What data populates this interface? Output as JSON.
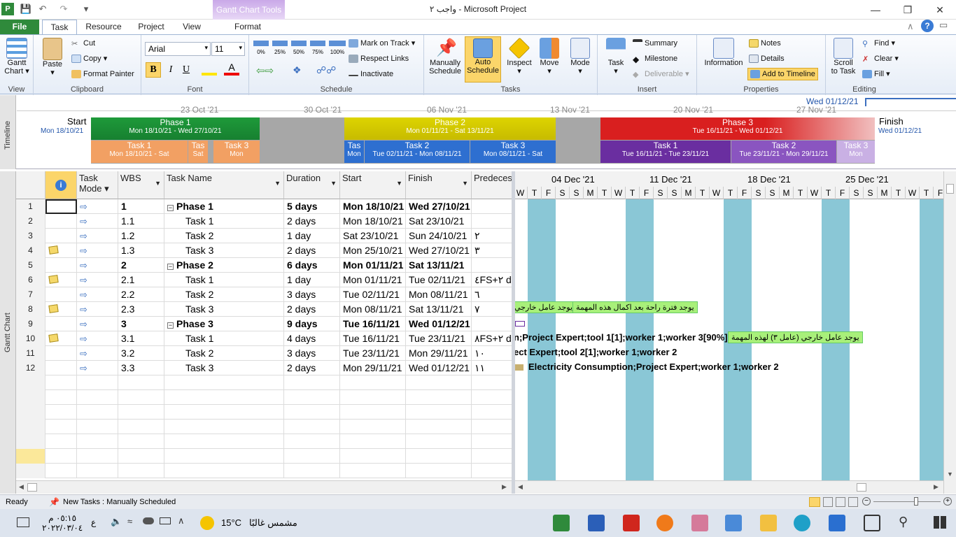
{
  "window": {
    "title": "واجب ٢  -  Microsoft Project",
    "contextual_tab": "Gantt Chart Tools"
  },
  "tabs": [
    {
      "label": "File"
    },
    {
      "label": "Task"
    },
    {
      "label": "Resource"
    },
    {
      "label": "Project"
    },
    {
      "label": "View"
    },
    {
      "label": "Format"
    }
  ],
  "ribbon": {
    "view": {
      "label": "View",
      "gantt": "Gantt",
      "gantt2": "Chart"
    },
    "clipboard": {
      "label": "Clipboard",
      "paste": "Paste",
      "cut": "Cut",
      "copy": "Copy",
      "painter": "Format Painter"
    },
    "font": {
      "label": "Font",
      "family": "Arial",
      "size": "11"
    },
    "schedule": {
      "label": "Schedule",
      "mark": "Mark on Track",
      "respect": "Respect Links",
      "inactivate": "Inactivate",
      "pcts": [
        "0%",
        "25%",
        "50%",
        "75%",
        "100%"
      ]
    },
    "tasks": {
      "label": "Tasks",
      "manual1": "Manually",
      "manual2": "Schedule",
      "auto1": "Auto",
      "auto2": "Schedule",
      "inspect": "Inspect",
      "move": "Move",
      "mode": "Mode"
    },
    "insert": {
      "label": "Insert",
      "task": "Task",
      "summary": "Summary",
      "milestone": "Milestone",
      "deliverable": "Deliverable"
    },
    "properties": {
      "label": "Properties",
      "information": "Information",
      "notes": "Notes",
      "details": "Details",
      "add_tl": "Add to Timeline"
    },
    "editing": {
      "label": "Editing",
      "scroll1": "Scroll",
      "scroll2": "to Task",
      "find": "Find",
      "clear": "Clear",
      "fill": "Fill"
    }
  },
  "timeline": {
    "side": "Timeline",
    "start_label": "Start",
    "start_date": "Mon 18/10/21",
    "finish_label": "Finish",
    "finish_date": "Wed 01/12/21",
    "today": "Wed 01/12/21",
    "ticks": [
      "23 Oct '21",
      "30 Oct '21",
      "06 Nov '21",
      "13 Nov '21",
      "20 Nov '21",
      "27 Nov '21"
    ],
    "phases": [
      {
        "name": "Phase 1",
        "dates": "Mon 18/10/21 - Wed 27/10/21",
        "color": "#1e9a3a"
      },
      {
        "name": "Phase 2",
        "dates": "Mon 01/11/21 - Sat 13/11/21",
        "color": "#d4c800"
      },
      {
        "name": "Phase 3",
        "dates": "Tue 16/11/21 - Wed 01/12/21",
        "color": "#d91f1f"
      }
    ],
    "tasks": [
      {
        "name": "Task 1",
        "dates": "Mon 18/10/21 - Sat"
      },
      {
        "name": "Tas",
        "dates": "Sat"
      },
      {
        "name": "Task 3",
        "dates": "Mon"
      },
      {
        "name": "Tas",
        "dates": "Mon"
      },
      {
        "name": "Task 2",
        "dates": "Tue 02/11/21 - Mon 08/11/21"
      },
      {
        "name": "Task 3",
        "dates": "Mon 08/11/21 - Sat"
      },
      {
        "name": "Task 1",
        "dates": "Tue 16/11/21 - Tue 23/11/21"
      },
      {
        "name": "Task 2",
        "dates": "Tue 23/11/21 - Mon 29/11/21"
      },
      {
        "name": "Task 3",
        "dates": "Mon"
      }
    ]
  },
  "grid": {
    "side": "Gantt Chart",
    "headers": {
      "mode1": "Task",
      "mode2": "Mode",
      "wbs": "WBS",
      "name": "Task Name",
      "duration": "Duration",
      "start": "Start",
      "finish": "Finish",
      "pred": "Predeces"
    },
    "rows": [
      {
        "id": "1",
        "wbs": "1",
        "name": "Phase 1",
        "dur": "5 days",
        "start": "Mon 18/10/21",
        "finish": "Wed 27/10/21",
        "pred": "",
        "summary": true,
        "note": false
      },
      {
        "id": "2",
        "wbs": "1.1",
        "name": "Task 1",
        "dur": "2 days",
        "start": "Mon 18/10/21",
        "finish": "Sat 23/10/21",
        "pred": "",
        "summary": false,
        "note": false
      },
      {
        "id": "3",
        "wbs": "1.2",
        "name": "Task 2",
        "dur": "1 day",
        "start": "Sat 23/10/21",
        "finish": "Sun 24/10/21",
        "pred": "٢",
        "summary": false,
        "note": false
      },
      {
        "id": "4",
        "wbs": "1.3",
        "name": "Task 3",
        "dur": "2 days",
        "start": "Mon 25/10/21",
        "finish": "Wed 27/10/21",
        "pred": "٣",
        "summary": false,
        "note": true
      },
      {
        "id": "5",
        "wbs": "2",
        "name": "Phase 2",
        "dur": "6 days",
        "start": "Mon 01/11/21",
        "finish": "Sat 13/11/21",
        "pred": "",
        "summary": true,
        "note": false
      },
      {
        "id": "6",
        "wbs": "2.1",
        "name": "Task 1",
        "dur": "1 day",
        "start": "Mon 01/11/21",
        "finish": "Tue 02/11/21",
        "pred": "٤FS+٢ d",
        "summary": false,
        "note": true
      },
      {
        "id": "7",
        "wbs": "2.2",
        "name": "Task 2",
        "dur": "3 days",
        "start": "Tue 02/11/21",
        "finish": "Mon 08/11/21",
        "pred": "٦",
        "summary": false,
        "note": false
      },
      {
        "id": "8",
        "wbs": "2.3",
        "name": "Task 3",
        "dur": "2 days",
        "start": "Mon 08/11/21",
        "finish": "Sat 13/11/21",
        "pred": "٧",
        "summary": false,
        "note": true
      },
      {
        "id": "9",
        "wbs": "3",
        "name": "Phase 3",
        "dur": "9 days",
        "start": "Tue 16/11/21",
        "finish": "Wed 01/12/21",
        "pred": "",
        "summary": true,
        "note": false
      },
      {
        "id": "10",
        "wbs": "3.1",
        "name": "Task 1",
        "dur": "4 days",
        "start": "Tue 16/11/21",
        "finish": "Tue 23/11/21",
        "pred": "٨FS+٢ d",
        "summary": false,
        "note": true
      },
      {
        "id": "11",
        "wbs": "3.2",
        "name": "Task 2",
        "dur": "3 days",
        "start": "Tue 23/11/21",
        "finish": "Mon 29/11/21",
        "pred": "١٠",
        "summary": false,
        "note": false
      },
      {
        "id": "12",
        "wbs": "3.3",
        "name": "Task 3",
        "dur": "2 days",
        "start": "Mon 29/11/21",
        "finish": "Wed 01/12/21",
        "pred": "١١",
        "summary": false,
        "note": false
      }
    ]
  },
  "chart": {
    "weeks": [
      "04 Dec '21",
      "11 Dec '21",
      "18 Dec '21",
      "25 Dec '21"
    ],
    "days": [
      "W",
      "T",
      "F",
      "S",
      "S",
      "M",
      "T",
      "W",
      "T",
      "F",
      "S",
      "S",
      "M",
      "T",
      "W",
      "T",
      "F",
      "S",
      "S",
      "M",
      "T",
      "W",
      "T",
      "F",
      "S",
      "S",
      "M",
      "T",
      "W",
      "T",
      "F"
    ],
    "note1": "يوجد عامل خارجي",
    "note2": "يوجد فترة راحة بعد اكمال هذه المهمة",
    "res10": "n;Project Expert;tool 1[1];worker 1;worker 3[90%]",
    "note3": "يوجد عامل خارجي (عامل ٣) لهذه المهمة",
    "res11": "ect Expert;tool 2[1];worker 1;worker 2",
    "res12": "Electricity Consumption;Project Expert;worker 1;worker 2"
  },
  "status": {
    "ready": "Ready",
    "new_tasks": "New Tasks : Manually Scheduled"
  },
  "taskbar": {
    "weather": "مشمس غالبًا",
    "temp": "15°C",
    "time": "٠٥:١٥ م",
    "date": "٢٠٢٢/٠٣/٠٤",
    "lang": "ع"
  }
}
